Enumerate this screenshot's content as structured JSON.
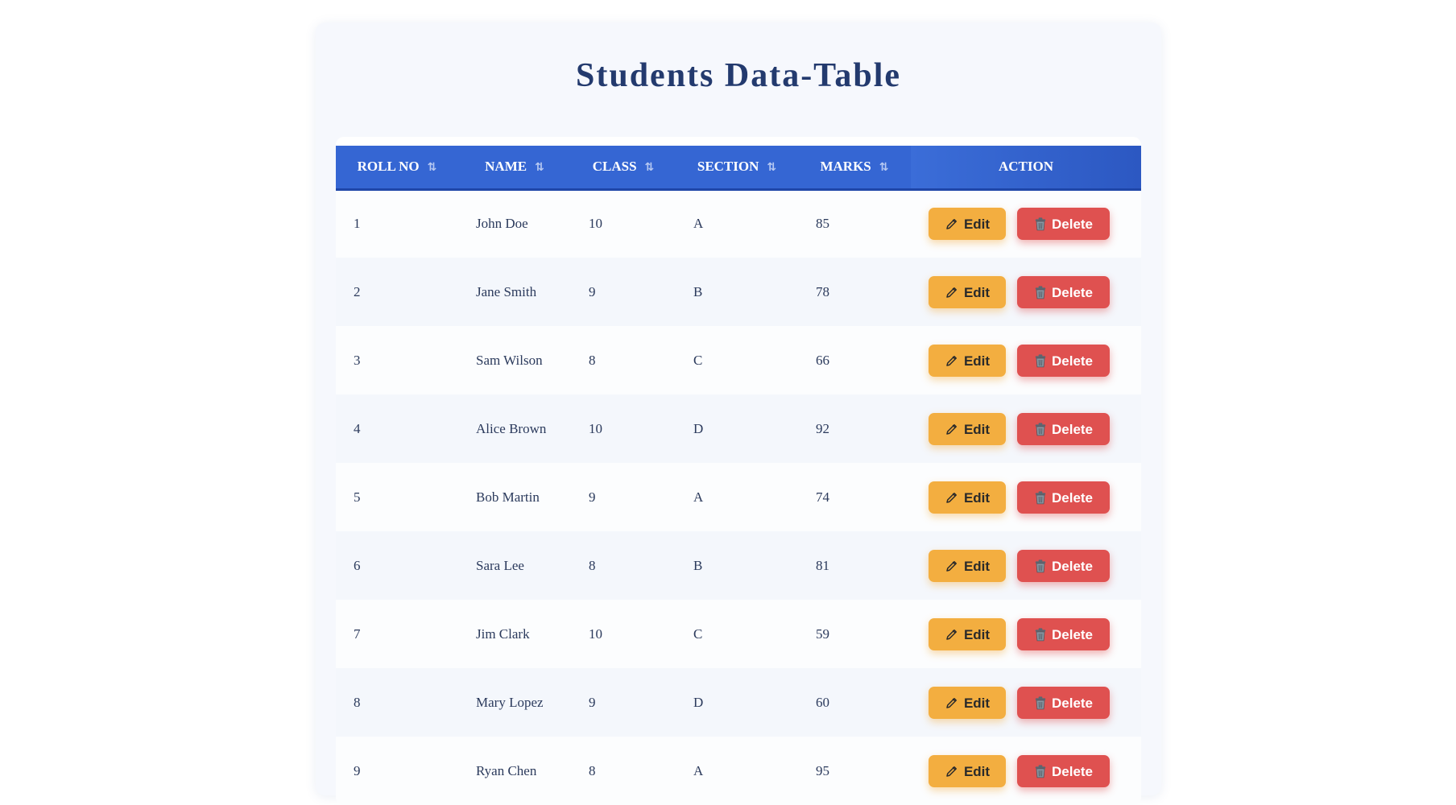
{
  "page": {
    "title": "Students Data-Table"
  },
  "colors": {
    "header_bg": "#3566d3",
    "title": "#233a6e",
    "edit_button": "#f3ae40",
    "delete_button": "#df5150"
  },
  "table": {
    "columns": [
      {
        "key": "roll",
        "label": "ROLL NO",
        "sortable": true
      },
      {
        "key": "name",
        "label": "NAME",
        "sortable": true
      },
      {
        "key": "class",
        "label": "CLASS",
        "sortable": true
      },
      {
        "key": "section",
        "label": "SECTION",
        "sortable": true
      },
      {
        "key": "marks",
        "label": "MARKS",
        "sortable": true
      },
      {
        "key": "action",
        "label": "ACTION",
        "sortable": false
      }
    ],
    "sort_icon": "⇅",
    "edit_label": "Edit",
    "delete_label": "Delete",
    "edit_icon": "pencil-icon",
    "delete_icon": "trash-icon",
    "rows": [
      {
        "roll": "1",
        "name": "John Doe",
        "class": "10",
        "section": "A",
        "marks": "85"
      },
      {
        "roll": "2",
        "name": "Jane Smith",
        "class": "9",
        "section": "B",
        "marks": "78"
      },
      {
        "roll": "3",
        "name": "Sam Wilson",
        "class": "8",
        "section": "C",
        "marks": "66"
      },
      {
        "roll": "4",
        "name": "Alice Brown",
        "class": "10",
        "section": "D",
        "marks": "92"
      },
      {
        "roll": "5",
        "name": "Bob Martin",
        "class": "9",
        "section": "A",
        "marks": "74"
      },
      {
        "roll": "6",
        "name": "Sara Lee",
        "class": "8",
        "section": "B",
        "marks": "81"
      },
      {
        "roll": "7",
        "name": "Jim Clark",
        "class": "10",
        "section": "C",
        "marks": "59"
      },
      {
        "roll": "8",
        "name": "Mary Lopez",
        "class": "9",
        "section": "D",
        "marks": "60"
      },
      {
        "roll": "9",
        "name": "Ryan Chen",
        "class": "8",
        "section": "A",
        "marks": "95"
      }
    ]
  }
}
